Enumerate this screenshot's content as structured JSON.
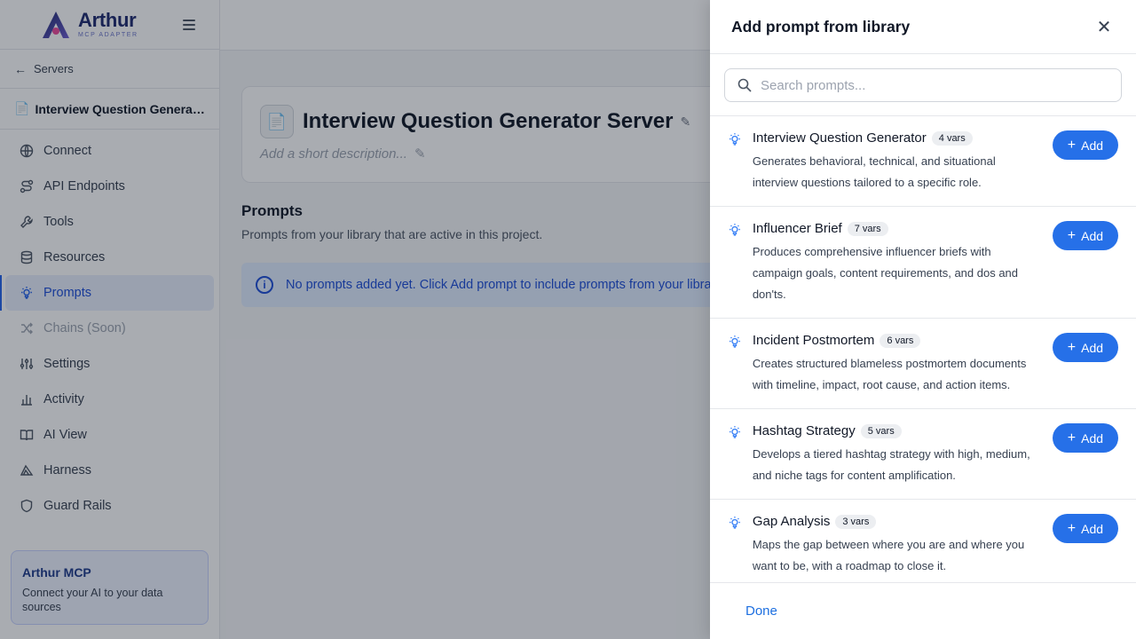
{
  "sidebar": {
    "brand_title": "Arthur",
    "brand_subtitle": "MCP ADAPTER",
    "back_label": "Servers",
    "server_name": "Interview Question Generator Server",
    "items": [
      {
        "label": "Connect",
        "icon": "globe-icon"
      },
      {
        "label": "API Endpoints",
        "icon": "route-icon"
      },
      {
        "label": "Tools",
        "icon": "wrench-icon"
      },
      {
        "label": "Resources",
        "icon": "database-icon"
      },
      {
        "label": "Prompts",
        "icon": "lightbulb-icon",
        "active": true
      },
      {
        "label": "Chains (Soon)",
        "icon": "shuffle-icon",
        "disabled": true
      },
      {
        "label": "Settings",
        "icon": "sliders-icon"
      },
      {
        "label": "Activity",
        "icon": "bar-chart-icon"
      },
      {
        "label": "AI View",
        "icon": "book-open-icon"
      },
      {
        "label": "Harness",
        "icon": "harness-icon"
      },
      {
        "label": "Guard Rails",
        "icon": "shield-icon"
      }
    ],
    "promo": {
      "title": "Arthur MCP",
      "text": "Connect your AI to your data sources"
    }
  },
  "main": {
    "server_title": "Interview Question Generator Server",
    "description_placeholder": "Add a short description...",
    "section_title": "Prompts",
    "section_subtitle": "Prompts from your library that are active in this project.",
    "info_text": "No prompts added yet. Click Add prompt to include prompts from your library."
  },
  "drawer": {
    "title": "Add prompt from library",
    "search_placeholder": "Search prompts...",
    "add_label": "Add",
    "done_label": "Done",
    "prompts": [
      {
        "name": "Interview Question Generator",
        "vars": "4 vars",
        "description": "Generates behavioral, technical, and situational interview questions tailored to a specific role."
      },
      {
        "name": "Influencer Brief",
        "vars": "7 vars",
        "description": "Produces comprehensive influencer briefs with campaign goals, content requirements, and dos and don'ts."
      },
      {
        "name": "Incident Postmortem",
        "vars": "6 vars",
        "description": "Creates structured blameless postmortem documents with timeline, impact, root cause, and action items."
      },
      {
        "name": "Hashtag Strategy",
        "vars": "5 vars",
        "description": "Develops a tiered hashtag strategy with high, medium, and niche tags for content amplification."
      },
      {
        "name": "Gap Analysis",
        "vars": "3 vars",
        "description": "Maps the gap between where you are and where you want to be, with a roadmap to close it."
      }
    ]
  },
  "colors": {
    "accent": "#2670e8",
    "brand": "#1e2a6e",
    "overlay": "rgba(17,24,39,0.36)"
  }
}
